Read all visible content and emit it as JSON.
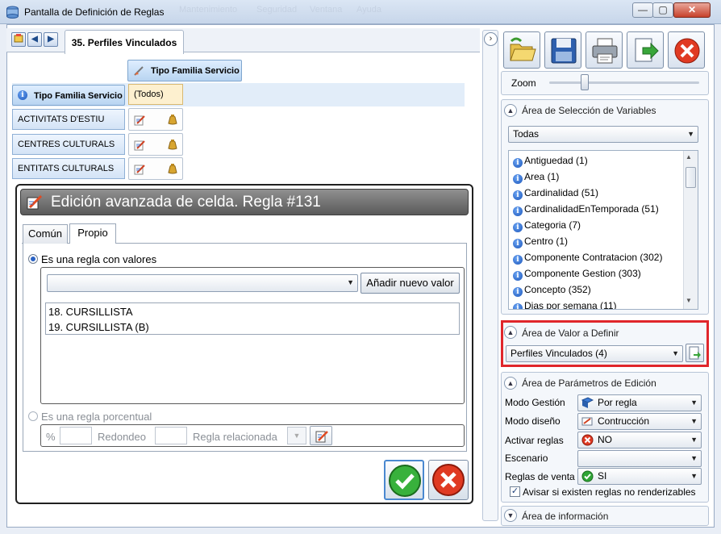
{
  "window": {
    "title": "Pantalla de Definición de Reglas",
    "menu_ghost": [
      "Mantenimiento",
      "Seguridad",
      "Ventana",
      "Ayuda"
    ],
    "controls": {
      "minimize": "—",
      "maximize": "▢",
      "close": "✕"
    }
  },
  "tabs": {
    "active": "35. Perfiles Vinculados"
  },
  "grid": {
    "column_header": "Tipo Familia Servicio",
    "row_header": "Tipo Familia Servicio",
    "row_header_value": "(Todos)",
    "rows": [
      "ACTIVITATS D'ESTIU",
      "CENTRES CULTURALS",
      "ENTITATS CULTURALS"
    ]
  },
  "toolbar": {
    "zoom_label": "Zoom",
    "zoom_level": 0.22
  },
  "variables_area": {
    "title": "Área de Selección de Variables",
    "filter": "Todas",
    "items": [
      "Antiguedad (1)",
      "Area (1)",
      "Cardinalidad (51)",
      "CardinalidadEnTemporada (51)",
      "Categoria (7)",
      "Centro (1)",
      "Componente Contratacion (302)",
      "Componente Gestion (303)",
      "Concepto (352)",
      "Dias por semana (11)"
    ]
  },
  "value_area": {
    "title": "Área de Valor a Definir",
    "selected": "Perfiles Vinculados (4)"
  },
  "params_area": {
    "title": "Área de Parámetros de Edición",
    "rows": [
      {
        "label": "Modo Gestión",
        "value": "Por regla"
      },
      {
        "label": "Modo diseño",
        "value": "Contrucción"
      },
      {
        "label": "Activar reglas",
        "value": "NO"
      },
      {
        "label": "Escenario",
        "value": ""
      },
      {
        "label": "Reglas de venta",
        "value": "SI"
      }
    ],
    "checkbox_label": "Avisar si existen reglas no renderizables",
    "checkbox_checked": true
  },
  "info_area": {
    "title": "Área de información"
  },
  "dialog": {
    "title": "Edición avanzada de celda. Regla #131",
    "tabs": [
      "Común",
      "Propio"
    ],
    "active_tab": "Propio",
    "option_values": "Es una regla con valores",
    "add_button": "Añadir nuevo valor",
    "values": [
      "18. CURSILLISTA",
      "19. CURSILLISTA (B)"
    ],
    "option_percent": "Es una regla porcentual",
    "percent_label": "%",
    "round_label": "Redondeo",
    "related_label": "Regla relacionada"
  },
  "colors": {
    "highlight_border": "#e0262b",
    "accent": "#2a62c4"
  }
}
